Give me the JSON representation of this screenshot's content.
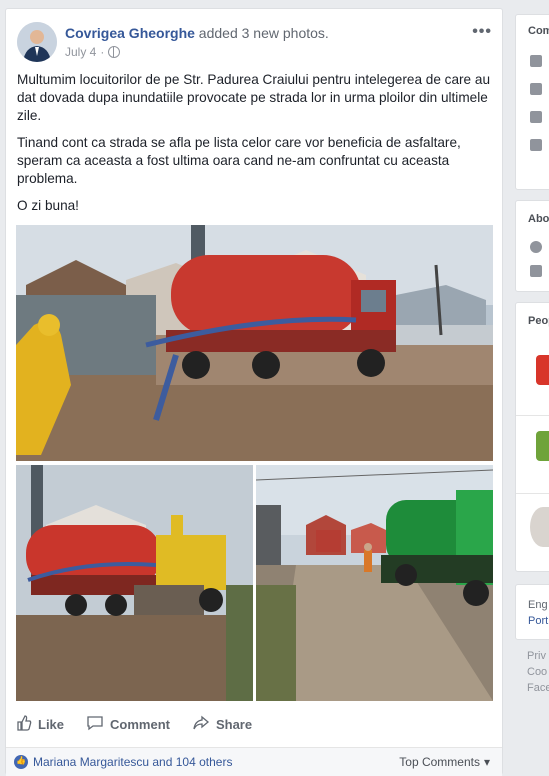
{
  "post": {
    "author": "Covrigea Gheorghe",
    "action": " added 3 new photos.",
    "date": "July 4",
    "more": "•••",
    "paragraphs": [
      "Multumim locuitorilor de pe Str. Padurea Craiului pentru intelegerea de care au dat dovada dupa inundatiile provocate pe strada lor in urma ploilor din ultimele zile.",
      "Tinand cont ca strada se afla pe lista celor care vor beneficia de asfaltare, speram ca aceasta a fost ultima oara cand ne-am confruntat cu aceasta problema.",
      "O zi buna!"
    ]
  },
  "actions": {
    "like": "Like",
    "comment": "Comment",
    "share": "Share"
  },
  "footer": {
    "likes_text": "Mariana Margaritescu and 104 others",
    "top_comments": "Top Comments"
  },
  "sidebar": {
    "card1_title": "Com",
    "card2_title": "Abo",
    "card3_title": "Peop",
    "lang1": "Eng",
    "lang2": "Port",
    "footer1": "Priv",
    "footer2": "Coo",
    "footer3": "Face"
  },
  "colors": {
    "link": "#365899",
    "background": "#e9ebee",
    "accent": "#4267b2"
  }
}
